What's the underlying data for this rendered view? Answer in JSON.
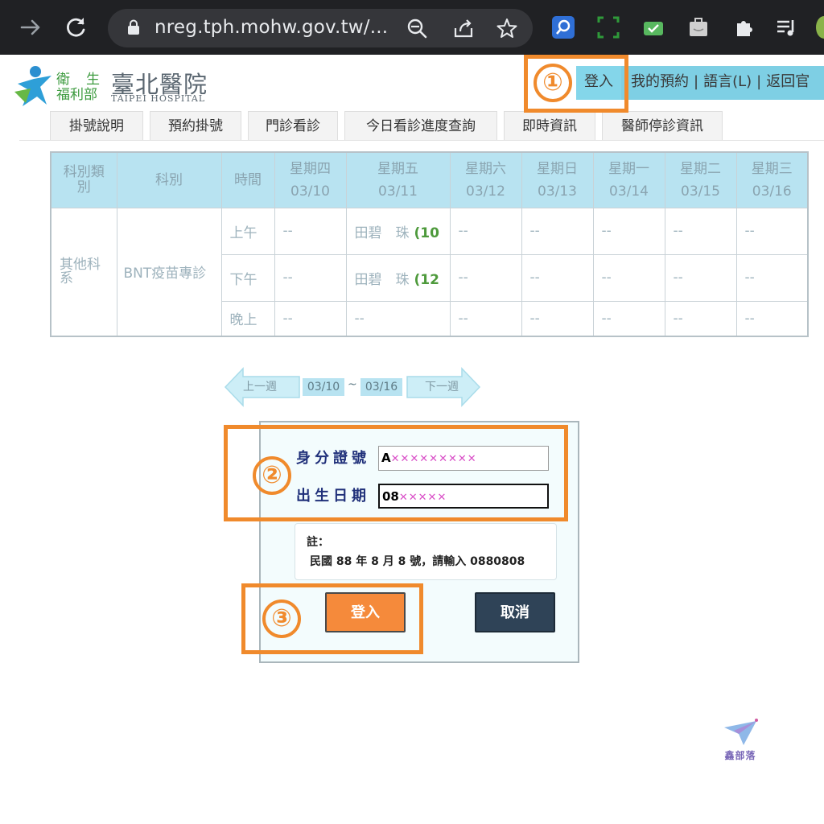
{
  "browser": {
    "url": "nreg.tph.mohw.gov.tw/...",
    "back_icon": "arrow-right-icon",
    "reload_icon": "reload-icon"
  },
  "site": {
    "ministry_line1": "衛生",
    "ministry_line2": "福利部",
    "hospital_name": "臺北醫院",
    "hospital_en": "TAIPEI HOSPITAL",
    "top_links": {
      "login": "登入",
      "my_booking": "我的預約",
      "language": "語言(L)",
      "back": "返回官"
    },
    "tabs": [
      "掛號說明",
      "預約掛號",
      "門診看診",
      "今日看診進度查詢",
      "即時資訊",
      "醫師停診資訊"
    ]
  },
  "schedule": {
    "headers": {
      "category": "科別類別",
      "department": "科別",
      "time": "時間"
    },
    "days": [
      {
        "weekday": "星期四",
        "date": "03/10"
      },
      {
        "weekday": "星期五",
        "date": "03/11"
      },
      {
        "weekday": "星期六",
        "date": "03/12"
      },
      {
        "weekday": "星期日",
        "date": "03/13"
      },
      {
        "weekday": "星期一",
        "date": "03/14"
      },
      {
        "weekday": "星期二",
        "date": "03/15"
      },
      {
        "weekday": "星期三",
        "date": "03/16"
      }
    ],
    "category": "其他科系",
    "department": "BNT疫苗專診",
    "slots": [
      {
        "time": "上午",
        "cells": [
          "--",
          {
            "doctor": "田碧　珠",
            "num": "(10"
          },
          "--",
          "--",
          "--",
          "--",
          "--"
        ]
      },
      {
        "time": "下午",
        "cells": [
          "--",
          {
            "doctor": "田碧　珠",
            "num": "(12"
          },
          "--",
          "--",
          "--",
          "--",
          "--"
        ]
      },
      {
        "time": "晚上",
        "cells": [
          "--",
          "--",
          "--",
          "--",
          "--",
          "--",
          "--"
        ]
      }
    ]
  },
  "week_nav": {
    "prev": "上一週",
    "start": "03/10",
    "tilde": "~",
    "end": "03/16",
    "next": "下一週"
  },
  "login_form": {
    "id_label": "身分證號",
    "id_value": "A",
    "id_mask": "✕✕✕✕✕✕✕✕✕",
    "dob_label": "出生日期",
    "dob_value": "08",
    "dob_mask": "✕✕✕✕✕",
    "note_title": "註：",
    "note_text": "民國 88 年 8 月 8 號，請輸入 0880808",
    "login_button": "登入",
    "cancel_button": "取消"
  },
  "annotations": [
    "①",
    "②",
    "③"
  ],
  "watermark": "鑫部落",
  "colors": {
    "annotation": "#f08a2c",
    "header_bg": "#b8e3f1",
    "login_button": "#f58a3b",
    "cancel_button": "#2f4357"
  }
}
